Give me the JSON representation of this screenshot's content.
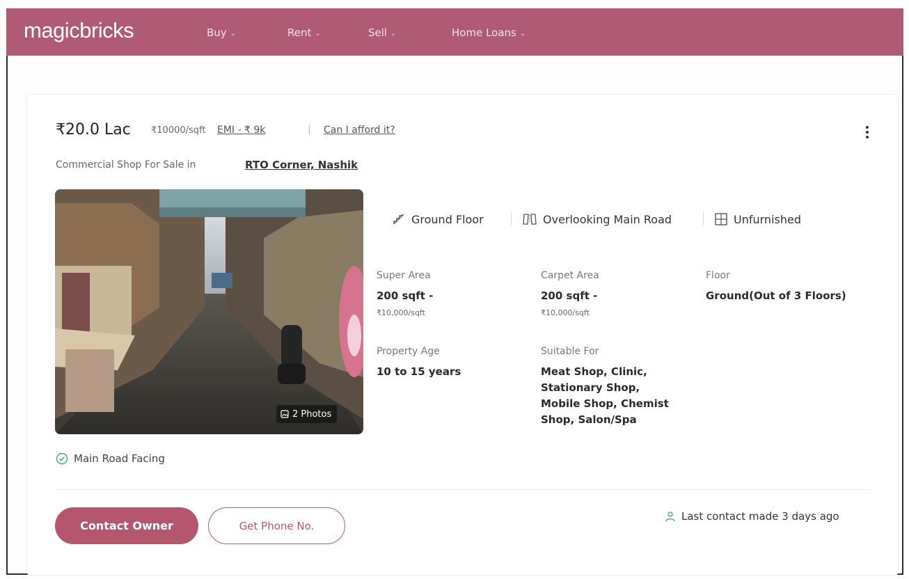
{
  "header": {
    "logo": "magicbricks",
    "nav": [
      {
        "label": "Buy"
      },
      {
        "label": "Rent"
      },
      {
        "label": "Sell"
      },
      {
        "label": "Home Loans"
      }
    ]
  },
  "listing": {
    "price": "₹20.0 Lac",
    "price_per_sqft": "₹10000/sqft",
    "emi": "EMI - ₹ 9k",
    "afford": "Can I afford it?",
    "title_prefix": "Commercial Shop For Sale in",
    "location": "RTO Corner, Nashik",
    "photos_badge": "2 Photos",
    "features": [
      "Ground Floor",
      "Overlooking Main Road",
      "Unfurnished"
    ],
    "super_area": {
      "label": "Super Area",
      "value": "200 sqft -",
      "rate": "₹10,000/sqft"
    },
    "carpet_area": {
      "label": "Carpet Area",
      "value": "200 sqft -",
      "rate": "₹10,000/sqft"
    },
    "floor": {
      "label": "Floor",
      "value": "Ground(Out of 3 Floors)"
    },
    "property_age": {
      "label": "Property Age",
      "value": "10 to 15 years"
    },
    "suitable_for": {
      "label": "Suitable For",
      "lines": [
        "Meat Shop, Clinic,",
        "Stationary Shop,",
        "Mobile Shop, Chemist",
        "Shop, Salon/Spa"
      ]
    },
    "highlight": "Main Road Facing",
    "contact_button": "Contact Owner",
    "phone_button": "Get Phone No.",
    "last_contact": "Last contact made 3 days ago"
  },
  "colors": {
    "brand": "#b05a75",
    "button": "#b5566f",
    "success": "#3aa868"
  }
}
